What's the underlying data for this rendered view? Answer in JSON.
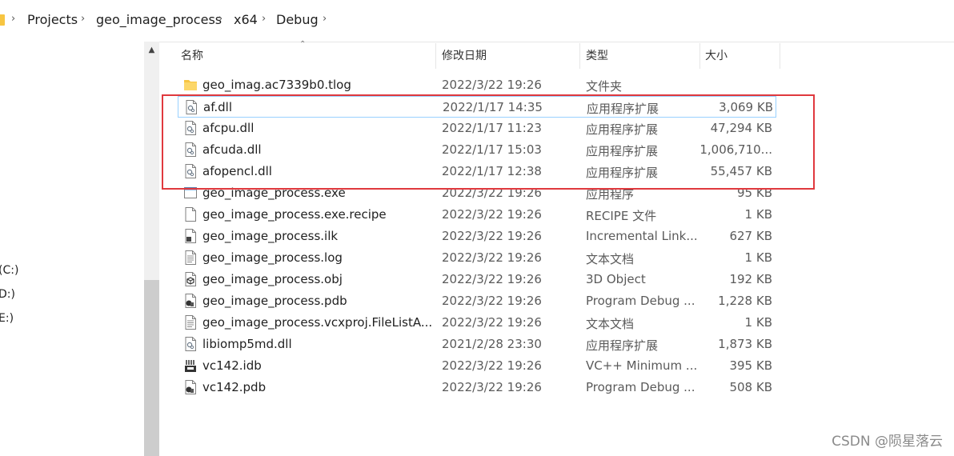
{
  "breadcrumb": {
    "items": [
      "Projects",
      "geo_image_process",
      "x64",
      "Debug"
    ]
  },
  "nav": {
    "drives": [
      "(C:)",
      "D:)",
      "E:)"
    ]
  },
  "columns": {
    "name": "名称",
    "date": "修改日期",
    "type": "类型",
    "size": "大小"
  },
  "files": [
    {
      "name": "geo_imag.ac7339b0.tlog",
      "date": "2022/3/22 19:26",
      "type": "文件夹",
      "size": "",
      "icon": "folder-icon"
    },
    {
      "name": "af.dll",
      "date": "2022/1/17 14:35",
      "type": "应用程序扩展",
      "size": "3,069 KB",
      "icon": "dll-file-icon"
    },
    {
      "name": "afcpu.dll",
      "date": "2022/1/17 11:23",
      "type": "应用程序扩展",
      "size": "47,294 KB",
      "icon": "dll-file-icon"
    },
    {
      "name": "afcuda.dll",
      "date": "2022/1/17 15:03",
      "type": "应用程序扩展",
      "size": "1,006,710...",
      "icon": "dll-file-icon"
    },
    {
      "name": "afopencl.dll",
      "date": "2022/1/17 12:38",
      "type": "应用程序扩展",
      "size": "55,457 KB",
      "icon": "dll-file-icon"
    },
    {
      "name": "geo_image_process.exe",
      "date": "2022/3/22 19:26",
      "type": "应用程序",
      "size": "95 KB",
      "icon": "exe-file-icon"
    },
    {
      "name": "geo_image_process.exe.recipe",
      "date": "2022/3/22 19:26",
      "type": "RECIPE 文件",
      "size": "1 KB",
      "icon": "blank-file-icon"
    },
    {
      "name": "geo_image_process.ilk",
      "date": "2022/3/22 19:26",
      "type": "Incremental Link...",
      "size": "627 KB",
      "icon": "ilk-file-icon"
    },
    {
      "name": "geo_image_process.log",
      "date": "2022/3/22 19:26",
      "type": "文本文档",
      "size": "1 KB",
      "icon": "text-file-icon"
    },
    {
      "name": "geo_image_process.obj",
      "date": "2022/3/22 19:26",
      "type": "3D Object",
      "size": "192 KB",
      "icon": "3d-object-file-icon"
    },
    {
      "name": "geo_image_process.pdb",
      "date": "2022/3/22 19:26",
      "type": "Program Debug ...",
      "size": "1,228 KB",
      "icon": "pdb-file-icon"
    },
    {
      "name": "geo_image_process.vcxproj.FileListA...",
      "date": "2022/3/22 19:26",
      "type": "文本文档",
      "size": "1 KB",
      "icon": "text-file-icon"
    },
    {
      "name": "libiomp5md.dll",
      "date": "2021/2/28 23:30",
      "type": "应用程序扩展",
      "size": "1,873 KB",
      "icon": "dll-file-icon"
    },
    {
      "name": "vc142.idb",
      "date": "2022/3/22 19:26",
      "type": "VC++ Minimum ...",
      "size": "395 KB",
      "icon": "idb-file-icon"
    },
    {
      "name": "vc142.pdb",
      "date": "2022/3/22 19:26",
      "type": "Program Debug ...",
      "size": "508 KB",
      "icon": "pdb-file-icon"
    }
  ],
  "watermark": "CSDN @陨星落云",
  "colors": {
    "highlight_box": "#e0393e",
    "selection_border": "#99d1ff",
    "folder": "#f7c542"
  }
}
